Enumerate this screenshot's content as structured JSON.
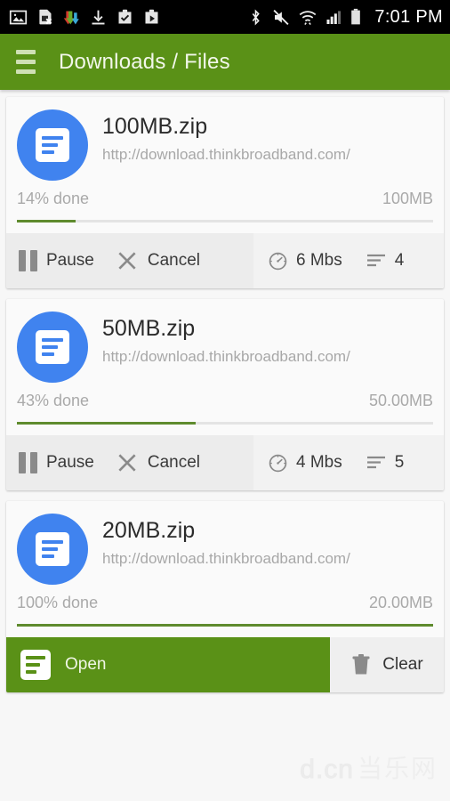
{
  "statusbar": {
    "time": "7:01 PM",
    "left_icons": [
      "image-icon",
      "sim-card-error-icon",
      "download-manager-icon",
      "download-arrow-icon",
      "clipboard-check-icon",
      "clipboard-play-icon"
    ],
    "right_icons": [
      "bluetooth-icon",
      "volume-muted-icon",
      "wifi-icon",
      "cellular-signal-icon",
      "battery-icon"
    ]
  },
  "appbar": {
    "title": "Downloads / Files",
    "menu_icon": "hamburger-icon",
    "background": "#5a9117"
  },
  "colors": {
    "accent_green": "#5a9117",
    "progress_green": "#5f8b2e",
    "file_icon_blue": "#4083ef"
  },
  "downloads": [
    {
      "name": "100MB.zip",
      "url": "http://download.thinkbroadband.com/",
      "progress_label": "14% done",
      "progress_percent": 14,
      "size": "100MB",
      "state": "downloading",
      "pause_label": "Pause",
      "cancel_label": "Cancel",
      "speed": "6 Mbs",
      "threads": "4"
    },
    {
      "name": "50MB.zip",
      "url": "http://download.thinkbroadband.com/",
      "progress_label": "43% done",
      "progress_percent": 43,
      "size": "50.00MB",
      "state": "downloading",
      "pause_label": "Pause",
      "cancel_label": "Cancel",
      "speed": "4 Mbs",
      "threads": "5"
    },
    {
      "name": "20MB.zip",
      "url": "http://download.thinkbroadband.com/",
      "progress_label": "100% done",
      "progress_percent": 100,
      "size": "20.00MB",
      "state": "complete",
      "open_label": "Open",
      "clear_label": "Clear"
    }
  ],
  "watermark": {
    "latin": "d.cn",
    "chinese": "当乐网"
  }
}
